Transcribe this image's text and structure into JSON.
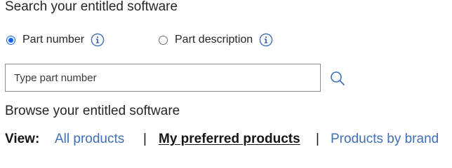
{
  "search_section": {
    "heading": "Search your entitled software",
    "radio_options": [
      {
        "label": "Part number",
        "checked": true,
        "info_icon": "info-icon"
      },
      {
        "label": "Part description",
        "checked": false,
        "info_icon": "info-icon"
      }
    ],
    "input": {
      "value": "",
      "placeholder": "Type part number"
    },
    "search_icon": "search-icon"
  },
  "browse_section": {
    "heading": "Browse your entitled software",
    "view_label": "View:",
    "links": [
      {
        "label": "All products",
        "active": false
      },
      {
        "label": "My preferred products",
        "active": true
      },
      {
        "label": "Products by brand",
        "active": false
      }
    ],
    "separator": "|"
  },
  "colors": {
    "accent": "#0f62fe",
    "link": "#3f6fb5",
    "text": "#161616"
  }
}
